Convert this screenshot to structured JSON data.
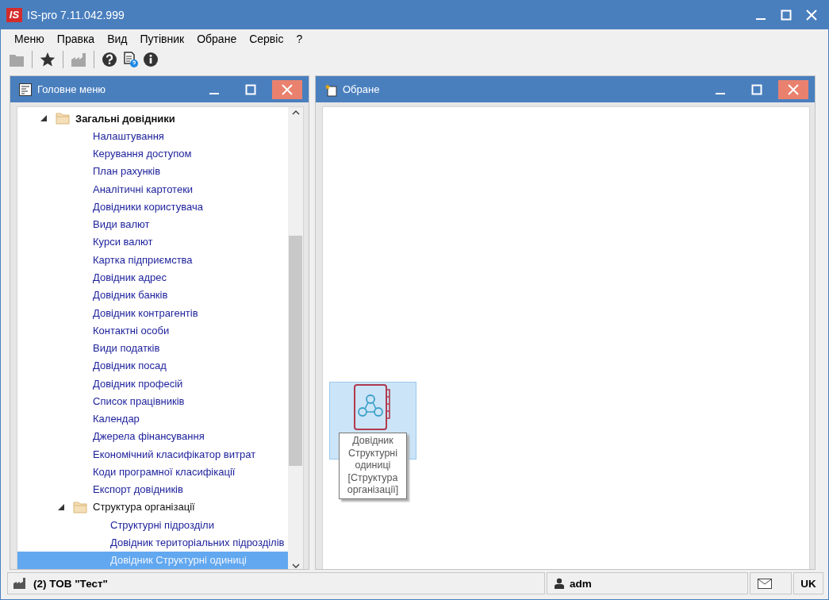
{
  "window": {
    "logo": "IS",
    "title": "IS-pro 7.11.042.999"
  },
  "menu": [
    "Меню",
    "Правка",
    "Вид",
    "Путівник",
    "Обране",
    "Сервіс",
    "?"
  ],
  "toolbar": [
    {
      "kind": "folder",
      "disabled": true
    },
    {
      "kind": "separator"
    },
    {
      "kind": "star",
      "disabled": false
    },
    {
      "kind": "separator"
    },
    {
      "kind": "factory",
      "disabled": true
    },
    {
      "kind": "separator"
    },
    {
      "kind": "help",
      "disabled": false
    },
    {
      "kind": "doc-help",
      "disabled": false
    },
    {
      "kind": "info",
      "disabled": false
    }
  ],
  "main_menu": {
    "title": "Головне меню",
    "tree": [
      {
        "label": "Загальні довідники",
        "expanded": true,
        "selected": false,
        "children": [
          {
            "label": "Налаштування",
            "selected": false
          },
          {
            "label": "Керування доступом",
            "selected": false
          },
          {
            "label": "План рахунків",
            "selected": false
          },
          {
            "label": "Аналітичні картотеки",
            "selected": false
          },
          {
            "label": "Довідники користувача",
            "selected": false
          },
          {
            "label": "Види валют",
            "selected": false
          },
          {
            "label": "Курси валют",
            "selected": false
          },
          {
            "label": "Картка підприємства",
            "selected": false
          },
          {
            "label": "Довідник адрес",
            "selected": false
          },
          {
            "label": "Довідник банків",
            "selected": false
          },
          {
            "label": "Довідник контрагентів",
            "selected": false
          },
          {
            "label": "Контактні особи",
            "selected": false
          },
          {
            "label": "Види податків",
            "selected": false
          },
          {
            "label": "Довідник посад",
            "selected": false
          },
          {
            "label": "Довідник професій",
            "selected": false
          },
          {
            "label": "Список працівників",
            "selected": false
          },
          {
            "label": "Календар",
            "selected": false
          },
          {
            "label": "Джерела фінансування",
            "selected": false
          },
          {
            "label": "Економічний класифікатор витрат",
            "selected": false
          },
          {
            "label": "Коди програмної класифікації",
            "selected": false
          },
          {
            "label": "Експорт довідників",
            "selected": false
          },
          {
            "label": "Структура організації",
            "expanded": true,
            "selected": false,
            "children": [
              {
                "label": "Структурні підрозділи",
                "selected": false
              },
              {
                "label": "Довідник територіальних підрозділів",
                "selected": false
              },
              {
                "label": "Довідник Структурні одиниці",
                "selected": true
              }
            ]
          }
        ]
      }
    ]
  },
  "favorites": {
    "title": "Обране",
    "items": [
      {
        "selected": true,
        "tooltip": "Довідник Структурні одиниці [Структура організації]"
      }
    ]
  },
  "status_bar": {
    "company": "(2) ТОВ \"Тест\"",
    "user": "adm",
    "language": "UK"
  }
}
